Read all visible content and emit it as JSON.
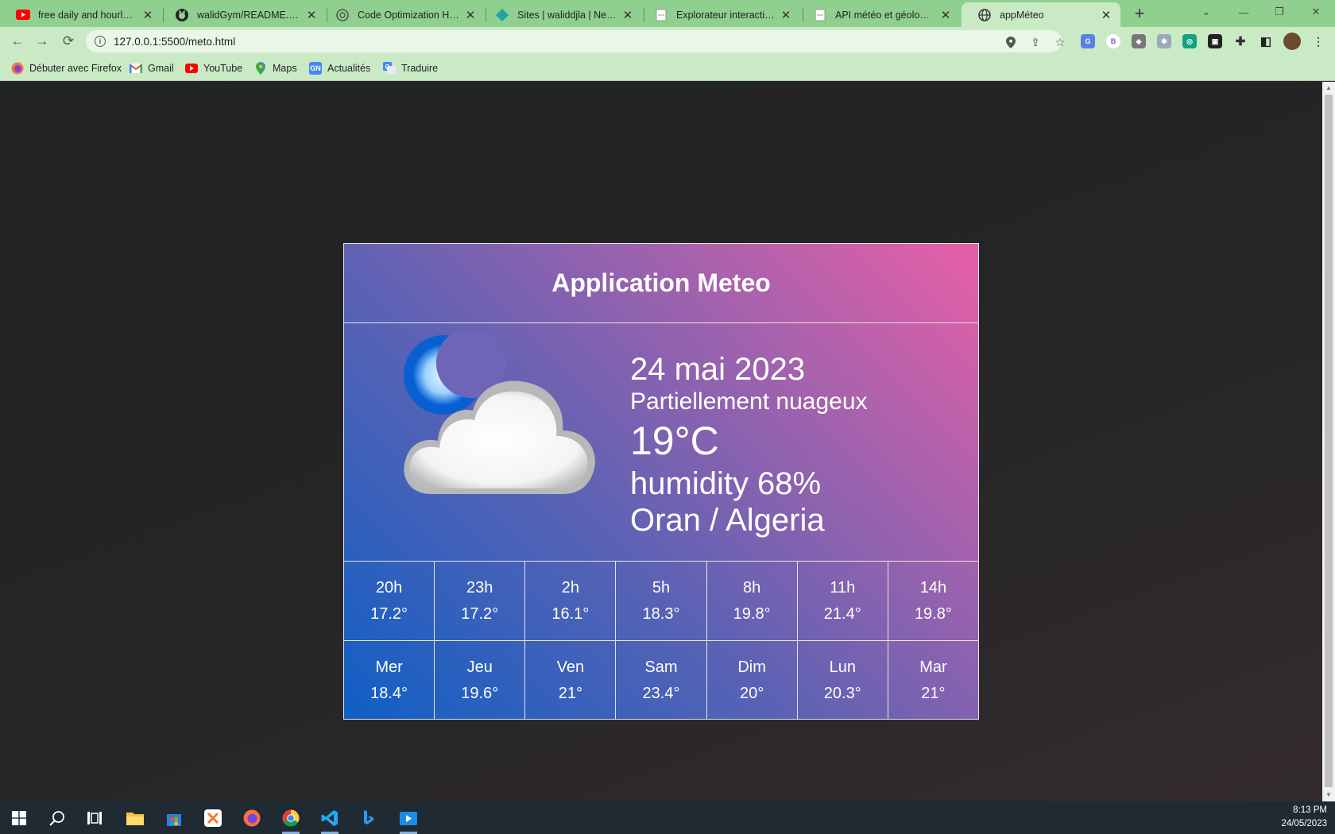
{
  "browser": {
    "tabs": [
      {
        "title": "free daily and hourly wea",
        "icon": "youtube-icon"
      },
      {
        "title": "walidGym/README.md at",
        "icon": "github-icon"
      },
      {
        "title": "Code Optimization Help",
        "icon": "openai-icon"
      },
      {
        "title": "Sites | waliddjla | Netlify",
        "icon": "netlify-icon"
      },
      {
        "title": "Explorateur interactif de l",
        "icon": "page-icon"
      },
      {
        "title": "API météo et géolocalisat",
        "icon": "page-icon"
      },
      {
        "title": "appMéteo",
        "icon": "globe-icon"
      }
    ],
    "url": "127.0.0.1:5500/meto.html",
    "bookmarks": [
      {
        "label": "Débuter avec Firefox",
        "icon": "firefox-icon"
      },
      {
        "label": "Gmail",
        "icon": "gmail-icon"
      },
      {
        "label": "YouTube",
        "icon": "youtube-icon"
      },
      {
        "label": "Maps",
        "icon": "maps-icon"
      },
      {
        "label": "Actualités",
        "icon": "news-icon",
        "badge": "GN"
      },
      {
        "label": "Traduire",
        "icon": "translate-icon"
      }
    ],
    "extension_badge": "B"
  },
  "app": {
    "title": "Application Meteo",
    "date": "24 mai 2023",
    "description": "Partiellement nuageux",
    "temperature": "19°C",
    "humidity": "humidity 68%",
    "location": "Oran / Algeria",
    "icon": "moon-cloud-icon",
    "hourly": [
      {
        "label": "20h",
        "value": "17.2°"
      },
      {
        "label": "23h",
        "value": "17.2°"
      },
      {
        "label": "2h",
        "value": "16.1°"
      },
      {
        "label": "5h",
        "value": "18.3°"
      },
      {
        "label": "8h",
        "value": "19.8°"
      },
      {
        "label": "11h",
        "value": "21.4°"
      },
      {
        "label": "14h",
        "value": "19.8°"
      }
    ],
    "daily": [
      {
        "label": "Mer",
        "value": "18.4°"
      },
      {
        "label": "Jeu",
        "value": "19.6°"
      },
      {
        "label": "Ven",
        "value": "21°"
      },
      {
        "label": "Sam",
        "value": "23.4°"
      },
      {
        "label": "Dim",
        "value": "20°"
      },
      {
        "label": "Lun",
        "value": "20.3°"
      },
      {
        "label": "Mar",
        "value": "21°"
      }
    ]
  },
  "taskbar": {
    "time": "8:13 PM",
    "date": "24/05/2023"
  },
  "colors": {
    "tab_bar": "#8fd08f",
    "toolbar": "#c9eac5",
    "card_gradient_start": "#0f5fc4",
    "card_gradient_end": "#e85fa7"
  }
}
